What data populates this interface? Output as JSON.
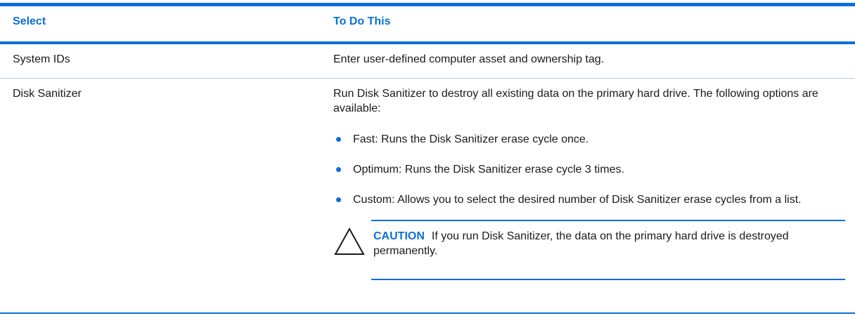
{
  "table": {
    "headers": {
      "select": "Select",
      "todo": "To Do This"
    },
    "rows": [
      {
        "select": "System IDs",
        "todo": "Enter user-defined computer asset and ownership tag."
      },
      {
        "select": "Disk Sanitizer",
        "intro": "Run Disk Sanitizer to destroy all existing data on the primary hard drive. The following options are available:",
        "options": [
          "Fast: Runs the Disk Sanitizer erase cycle once.",
          "Optimum: Runs the Disk Sanitizer erase cycle 3 times.",
          "Custom: Allows you to select the desired number of Disk Sanitizer erase cycles from a list."
        ],
        "caution": {
          "label": "CAUTION",
          "text": "If you run Disk Sanitizer, the data on the primary hard drive is destroyed permanently.",
          "icon": "caution-triangle-icon"
        }
      }
    ]
  },
  "colors": {
    "accent": "#0b6fd6",
    "text": "#1a1a1a",
    "row_divider": "#b9c9d8"
  }
}
